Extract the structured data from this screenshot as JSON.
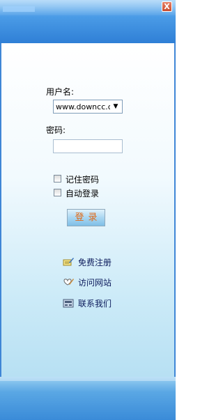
{
  "window": {
    "close_label": "X"
  },
  "form": {
    "username_label": "用户名:",
    "username_value": "www.downcc.c",
    "password_label": "密码:",
    "password_value": "",
    "remember_label": "记住密码",
    "autologin_label": "自动登录",
    "login_label": "登录"
  },
  "links": [
    {
      "label": "免费注册",
      "icon": "register-icon"
    },
    {
      "label": "访问网站",
      "icon": "heart-pen-icon"
    },
    {
      "label": "联系我们",
      "icon": "contact-icon"
    }
  ]
}
